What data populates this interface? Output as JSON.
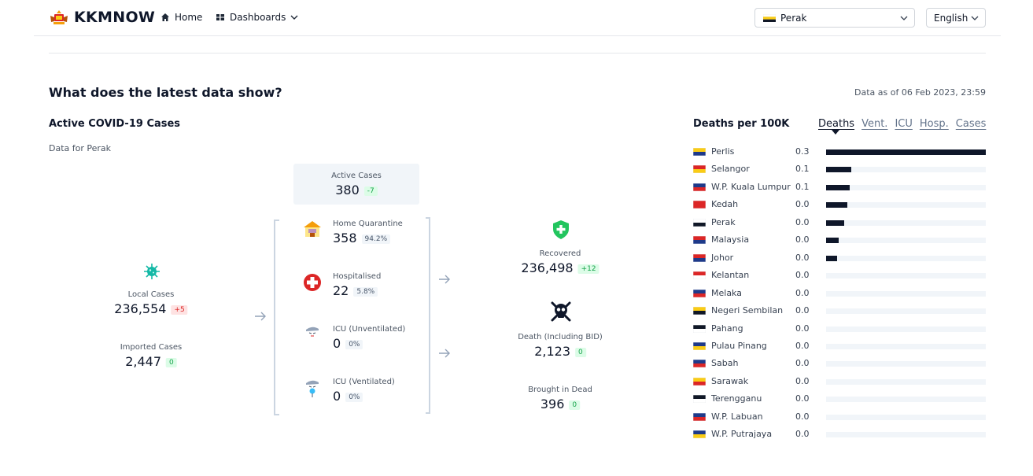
{
  "header": {
    "brand": "KKMNOW",
    "nav_home": "Home",
    "nav_dashboards": "Dashboards",
    "state_select": "Perak",
    "language_select": "English"
  },
  "section": {
    "title": "What does the latest data show?",
    "data_as_of": "Data as of 06 Feb 2023, 23:59"
  },
  "active_card": {
    "title": "Active COVID-19 Cases",
    "subtitle": "Data for Perak",
    "local_label": "Local Cases",
    "local_value": "236,554",
    "local_delta": "+5",
    "imported_label": "Imported Cases",
    "imported_value": "2,447",
    "imported_delta": "0",
    "active_label": "Active Cases",
    "active_value": "380",
    "active_delta": "-7",
    "home_label": "Home Quarantine",
    "home_value": "358",
    "home_pct": "94.2%",
    "hosp_label": "Hospitalised",
    "hosp_value": "22",
    "hosp_pct": "5.8%",
    "icu_unvent_label": "ICU (Unventilated)",
    "icu_unvent_value": "0",
    "icu_unvent_pct": "0%",
    "icu_vent_label": "ICU (Ventilated)",
    "icu_vent_value": "0",
    "icu_vent_pct": "0%",
    "recovered_label": "Recovered",
    "recovered_value": "236,498",
    "recovered_delta": "+12",
    "death_label": "Death (Including BID)",
    "death_value": "2,123",
    "death_delta": "0",
    "bid_label": "Brought in Dead",
    "bid_value": "396",
    "bid_delta": "0"
  },
  "deaths_panel": {
    "title": "Deaths per 100K",
    "tabs": [
      "Deaths",
      "Vent.",
      "ICU",
      "Hosp.",
      "Cases"
    ],
    "active_tab": "Deaths"
  },
  "chart_data": {
    "type": "bar",
    "title": "Deaths per 100K",
    "categories": [
      "Perlis",
      "Selangor",
      "W.P. Kuala Lumpur",
      "Kedah",
      "Perak",
      "Malaysia",
      "Johor",
      "Kelantan",
      "Melaka",
      "Negeri Sembilan",
      "Pahang",
      "Pulau Pinang",
      "Sabah",
      "Sarawak",
      "Terengganu",
      "W.P. Labuan",
      "W.P. Putrajaya"
    ],
    "labels": [
      "0.3",
      "0.1",
      "0.1",
      "0.0",
      "0.0",
      "0.0",
      "0.0",
      "0.0",
      "0.0",
      "0.0",
      "0.0",
      "0.0",
      "0.0",
      "0.0",
      "0.0",
      "0.0",
      "0.0"
    ],
    "values": [
      0.3,
      0.048,
      0.044,
      0.04,
      0.034,
      0.024,
      0.02,
      0,
      0,
      0,
      0,
      0,
      0,
      0,
      0,
      0,
      0
    ],
    "ylim": [
      0,
      0.3
    ],
    "bar_color": "#0f172a",
    "track_color": "#f1f5f9"
  }
}
